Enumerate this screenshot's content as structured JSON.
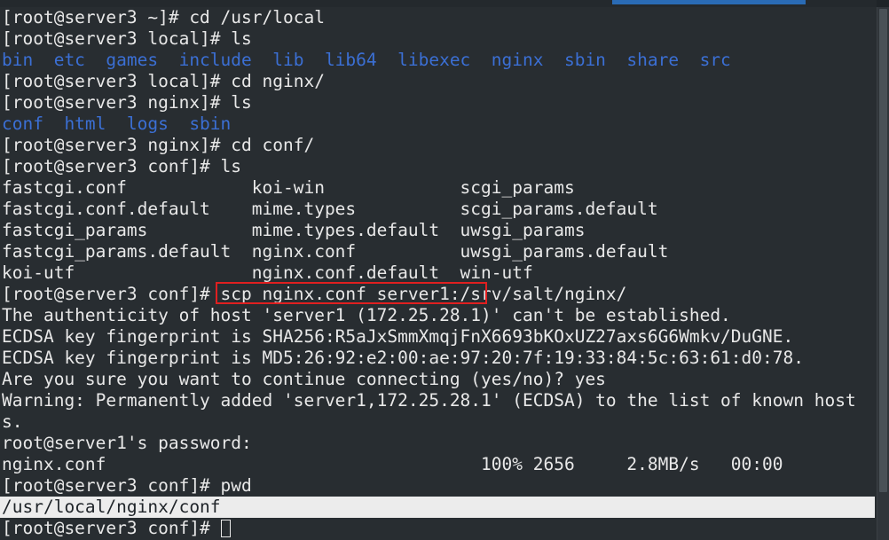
{
  "window": {
    "tab_accent_color": "#2a6bb5",
    "background_color": "#282d31",
    "foreground_color": "#e8e8e8",
    "directory_color": "#3b6fd4",
    "annotation_color": "#e02020",
    "selection_background": "#ececec",
    "selection_foreground": "#20252a"
  },
  "terminal": {
    "lines": [
      {
        "text": "[root@server3 ~]# cd /usr/local"
      },
      {
        "text": "[root@server3 local]# ls"
      },
      {
        "text": "bin  etc  games  include  lib  lib64  libexec  nginx  sbin  share  src",
        "dir": true
      },
      {
        "text": "[root@server3 local]# cd nginx/"
      },
      {
        "text": "[root@server3 nginx]# ls"
      },
      {
        "text": "conf  html  logs  sbin",
        "dir": true
      },
      {
        "text": "[root@server3 nginx]# cd conf/"
      },
      {
        "text": "[root@server3 conf]# ls"
      },
      {
        "text": "fastcgi.conf            koi-win             scgi_params"
      },
      {
        "text": "fastcgi.conf.default    mime.types          scgi_params.default"
      },
      {
        "text": "fastcgi_params          mime.types.default  uwsgi_params"
      },
      {
        "text": "fastcgi_params.default  nginx.conf          uwsgi_params.default"
      },
      {
        "text": "koi-utf                 nginx.conf.default  win-utf"
      },
      {
        "text": "[root@server3 conf]# scp nginx.conf server1:/srv/salt/nginx/"
      },
      {
        "text": "The authenticity of host 'server1 (172.25.28.1)' can't be established."
      },
      {
        "text": "ECDSA key fingerprint is SHA256:R5aJxSmmXmqjFnX6693bKOxUZ27axs6G6Wmkv/DuGNE."
      },
      {
        "text": "ECDSA key fingerprint is MD5:26:92:e2:00:ae:97:20:7f:19:33:84:5c:63:61:d0:78."
      },
      {
        "text": "Are you sure you want to continue connecting (yes/no)? yes"
      },
      {
        "text": "Warning: Permanently added 'server1,172.25.28.1' (ECDSA) to the list of known host"
      },
      {
        "text": "s."
      },
      {
        "text": "root@server1's password:"
      },
      {
        "text": "nginx.conf                                    100% 2656     2.8MB/s   00:00"
      },
      {
        "text": "[root@server3 conf]# pwd"
      },
      {
        "text": "/usr/local/nginx/conf",
        "selected": true
      },
      {
        "text": "[root@server3 conf]# ",
        "cursor": true
      }
    ],
    "command_highlighted": "scp nginx.conf server1:/srv/salt/nginx/",
    "host": "server3",
    "user": "root",
    "remote_host": "server1",
    "remote_ip": "172.25.28.1",
    "current_directory": "/usr/local/nginx/conf",
    "transfer": {
      "file": "nginx.conf",
      "percent": "100%",
      "bytes": "2656",
      "rate": "2.8MB/s",
      "eta": "00:00"
    }
  }
}
